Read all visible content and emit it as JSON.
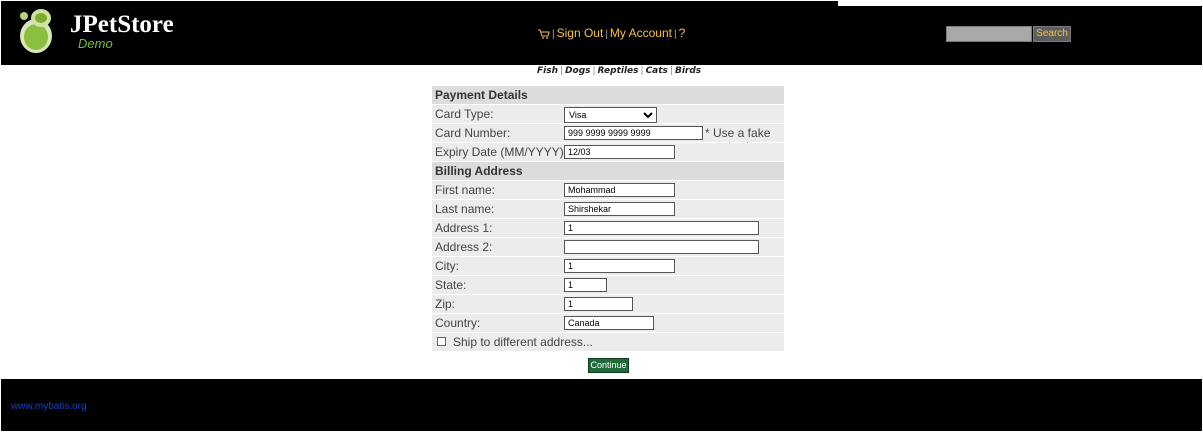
{
  "header": {
    "logo_title": "JPetStore",
    "logo_subtitle": "Demo",
    "menu": {
      "sign_out": "Sign Out",
      "my_account": "My Account",
      "help": "?"
    },
    "search": {
      "value": "",
      "button_label": "Search"
    }
  },
  "quick_links": [
    "Fish",
    "Dogs",
    "Reptiles",
    "Cats",
    "Birds"
  ],
  "form": {
    "payment_section": "Payment Details",
    "card_type_label": "Card Type:",
    "card_type_value": "Visa",
    "card_number_label": "Card Number:",
    "card_number_value": "999 9999 9999 9999",
    "card_number_note": "* Use a fake number!",
    "expiry_label": "Expiry Date (MM/YYYY):",
    "expiry_value": "12/03",
    "billing_section": "Billing Address",
    "first_name_label": "First name:",
    "first_name_value": "Mohammad",
    "last_name_label": "Last name:",
    "last_name_value": "Shirshekar",
    "address1_label": "Address 1:",
    "address1_value": "1",
    "address2_label": "Address 2:",
    "address2_value": "",
    "city_label": "City:",
    "city_value": "1",
    "state_label": "State:",
    "state_value": "1",
    "zip_label": "Zip:",
    "zip_value": "1",
    "country_label": "Country:",
    "country_value": "Canada",
    "ship_label": "Ship to different address...",
    "ship_checked": false,
    "continue_label": "Continue"
  },
  "footer": {
    "link": "www.mybatis.org"
  },
  "colors": {
    "header_bg": "#000000",
    "link_gold": "#f5c242",
    "continue_green": "#1f6b3a",
    "footer_link": "#1e3fbf"
  }
}
